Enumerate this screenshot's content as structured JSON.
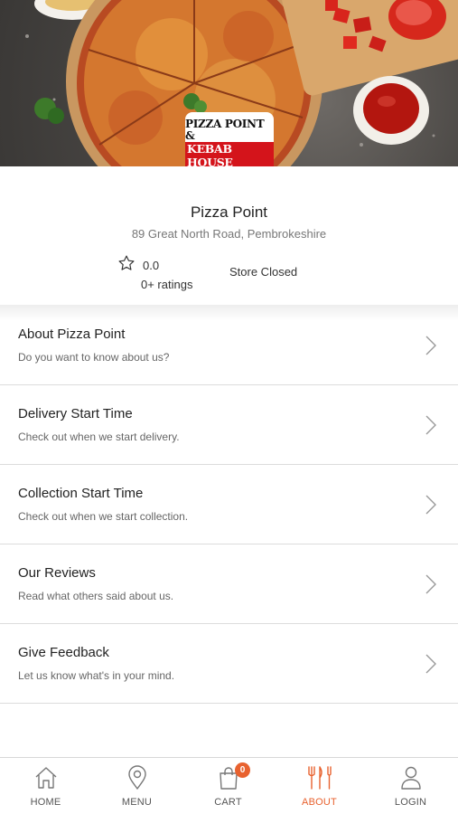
{
  "hero": {
    "logo_line1": "PIZZA POINT &",
    "logo_line2": "KEBAB HOUSE"
  },
  "store": {
    "name": "Pizza Point",
    "address": "89 Great North Road, Pembrokeshire",
    "rating": "0.0",
    "ratings_count": "0+ ratings",
    "status": "Store Closed"
  },
  "menu": [
    {
      "title": "About Pizza Point",
      "subtitle": "Do you want to know about us?"
    },
    {
      "title": "Delivery Start Time",
      "subtitle": "Check out when we start delivery."
    },
    {
      "title": "Collection Start Time",
      "subtitle": "Check out when we start collection."
    },
    {
      "title": "Our Reviews",
      "subtitle": "Read what others said about us."
    },
    {
      "title": "Give Feedback",
      "subtitle": "Let us know what's in your mind."
    }
  ],
  "nav": {
    "home": "HOME",
    "menu": "MENU",
    "cart": "CART",
    "cart_count": "0",
    "about": "ABOUT",
    "login": "LOGIN",
    "active": "about"
  },
  "colors": {
    "accent": "#e8622f",
    "logo_red": "#d4141b",
    "divider": "#dcdcdc"
  }
}
